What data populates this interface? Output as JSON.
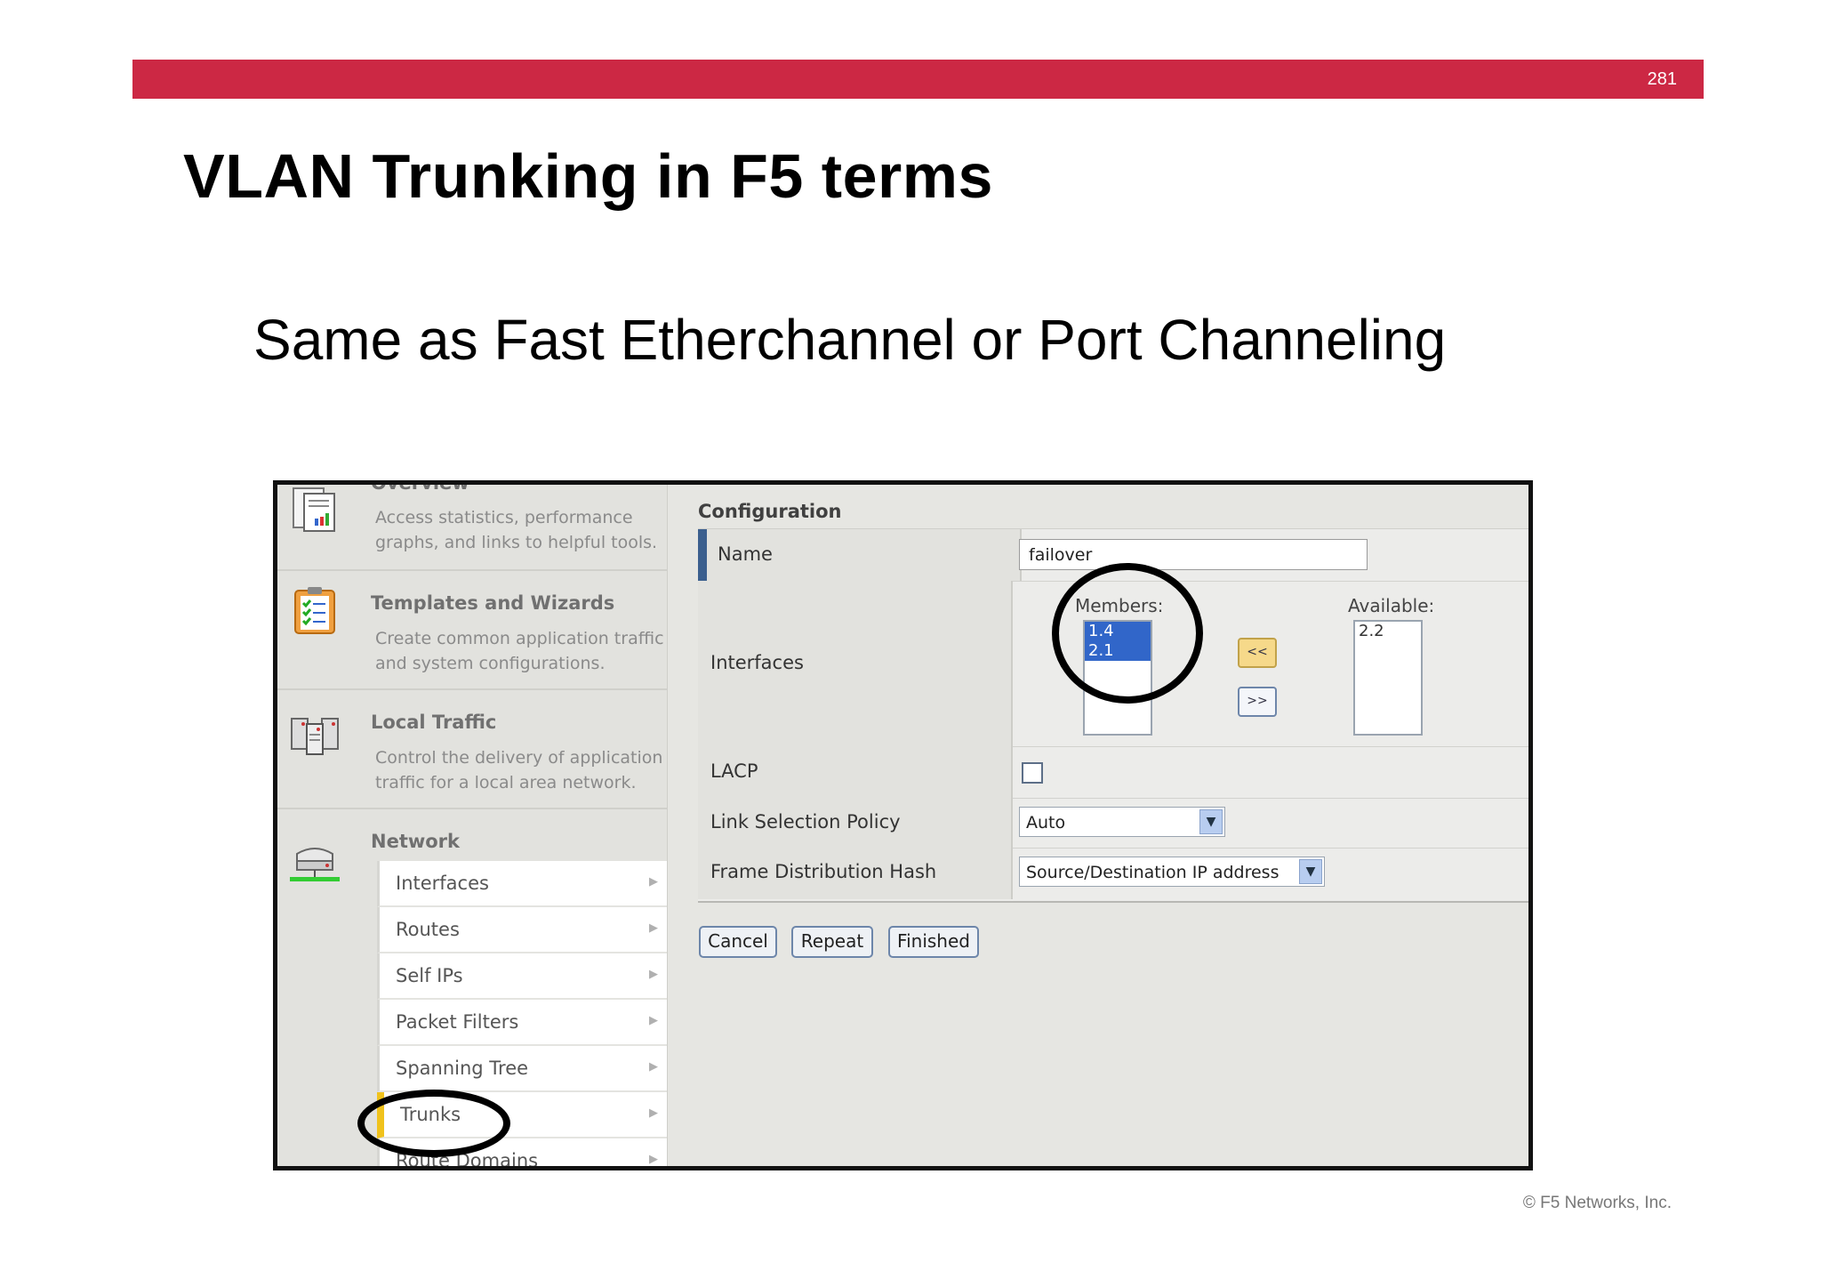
{
  "slide": {
    "page_number": "281",
    "title": "VLAN Trunking in F5 terms",
    "subtitle": "Same as Fast Etherchannel or Port Channeling",
    "copyright": "© F5 Networks, Inc."
  },
  "colors": {
    "accent_bar": "#cc2844",
    "nav_active": "#f0c21c",
    "row_marker": "#3b5f8e"
  },
  "leftnav": {
    "sections": [
      {
        "title": "Overview",
        "desc1": "Access statistics, performance",
        "desc2": "graphs, and links to helpful tools.",
        "icon": "report-icon"
      },
      {
        "title": "Templates and Wizards",
        "desc1": "Create common application traffic",
        "desc2": "and system configurations.",
        "icon": "clipboard-checklist-icon"
      },
      {
        "title": "Local Traffic",
        "desc1": "Control the delivery of application",
        "desc2": "traffic for a local area network.",
        "icon": "servers-icon"
      },
      {
        "title": "Network",
        "icon": "network-device-icon"
      }
    ],
    "network_items": [
      {
        "label": "Interfaces"
      },
      {
        "label": "Routes"
      },
      {
        "label": "Self IPs"
      },
      {
        "label": "Packet Filters"
      },
      {
        "label": "Spanning Tree"
      },
      {
        "label": "Trunks",
        "active": true
      },
      {
        "label": "Route Domains"
      }
    ]
  },
  "config": {
    "heading": "Configuration",
    "name_label": "Name",
    "name_value": "failover",
    "interfaces_label": "Interfaces",
    "members_label": "Members:",
    "members": [
      "1.4",
      "2.1"
    ],
    "available_label": "Available:",
    "available": [
      "2.2"
    ],
    "move_left": "<<",
    "move_right": ">>",
    "lacp_label": "LACP",
    "lacp_checked": false,
    "link_policy_label": "Link Selection Policy",
    "link_policy_value": "Auto",
    "hash_label": "Frame Distribution Hash",
    "hash_value": "Source/Destination IP address"
  },
  "buttons": {
    "cancel": "Cancel",
    "repeat": "Repeat",
    "finished": "Finished"
  }
}
